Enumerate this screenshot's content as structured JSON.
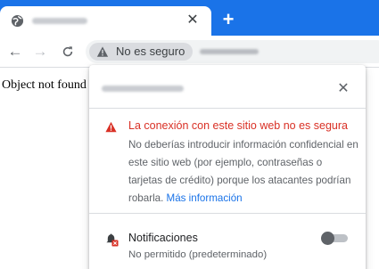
{
  "browser": {
    "accent_color": "#1a73e8",
    "tab": {
      "favicon": "globe-icon",
      "close_label": "✕"
    },
    "new_tab_label": "+",
    "toolbar": {
      "back_label": "←",
      "forward_label": "→",
      "reload_label": "C"
    },
    "omnibox": {
      "security_chip_icon": "warning-triangle-icon",
      "security_chip_text": "No es seguro"
    }
  },
  "page": {
    "body_text": "Object not found"
  },
  "security_popup": {
    "close_label": "✕",
    "warning": {
      "icon": "warning-triangle-icon",
      "color": "#d93025",
      "title": "La conexión con este sitio web no es segura",
      "body": "No deberías introducir información confidencial en este sitio web (por ejemplo, contraseñas o tarjetas de crédito) porque los atacantes podrían robarla.",
      "link_text": "Más información",
      "link_color": "#1a73e8"
    },
    "permissions": [
      {
        "icon": "notifications-blocked-icon",
        "title": "Notificaciones",
        "subtitle": "No permitido (predeterminado)",
        "enabled": false
      }
    ]
  }
}
